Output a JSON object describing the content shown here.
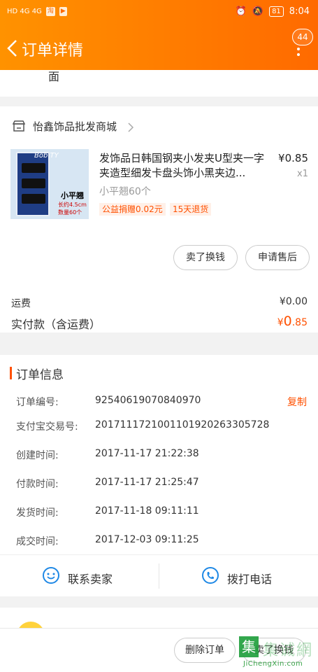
{
  "status_bar": {
    "signal_text": "HD 4G 4G",
    "time": "8:04",
    "battery": "81"
  },
  "header": {
    "title": "订单详情",
    "badge_count": "44"
  },
  "partial_text": "面",
  "shop": {
    "name": "怡鑫饰品批发商城",
    "product": {
      "title": "发饰品日韩国钢夹小发夹U型夹一字夹造型细发卡盘头饰小黑夹边...",
      "price": "¥0.85",
      "qty": "x1",
      "sku": "小平翘60个",
      "tags": [
        "公益捐赠0.02元",
        "15天退货"
      ],
      "image_text": {
        "brand": "Bob TY",
        "line1": "小平翘",
        "line2": "长约4.5cm",
        "line3": "数量60个"
      }
    },
    "buttons": {
      "sell": "卖了换钱",
      "after_sales": "申请售后"
    },
    "freight": {
      "label": "运费",
      "value": "¥0.00"
    },
    "total": {
      "label": "实付款（含运费）",
      "currency": "¥",
      "int": "0",
      "dec": ".85"
    }
  },
  "order_info": {
    "title": "订单信息",
    "copy_label": "复制",
    "rows": [
      {
        "label": "订单编号:",
        "value": "92540619070840970"
      },
      {
        "label": "支付宝交易号:",
        "value": "20171117210011019202633057​28"
      },
      {
        "label": "创建时间:",
        "value": "2017-11-17 21:22:38"
      },
      {
        "label": "付款时间:",
        "value": "2017-11-17 21:25:47"
      },
      {
        "label": "发货时间:",
        "value": "2017-11-18 09:11:11"
      },
      {
        "label": "成交时间:",
        "value": "2017-12-03 09:11:25"
      }
    ]
  },
  "contact": {
    "seller": "联系卖家",
    "call": "拨打电话"
  },
  "bottom_bar": {
    "delete": "删除订单",
    "sell": "卖了换钱"
  },
  "watermark": {
    "text": "集诚網",
    "url": "JiChengXin.com"
  },
  "colors": {
    "accent": "#ff5000",
    "header_start": "#ff9200",
    "header_end": "#ff6a00"
  }
}
